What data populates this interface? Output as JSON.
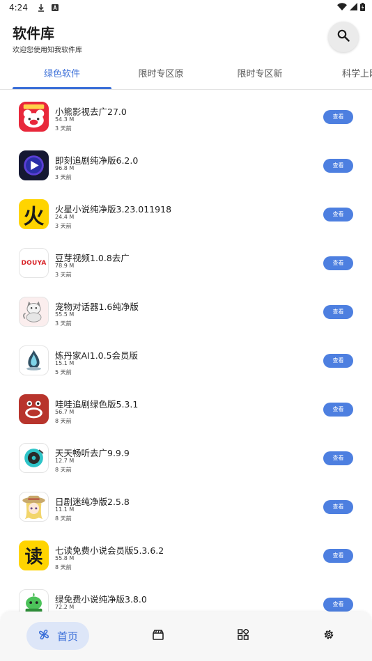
{
  "status_bar": {
    "time": "4:24"
  },
  "header": {
    "title": "软件库",
    "subtitle": "欢迎您使用知我软件库"
  },
  "tabs": [
    {
      "label": "绿色软件",
      "active": true
    },
    {
      "label": "限时专区原",
      "active": false
    },
    {
      "label": "限时专区新",
      "active": false
    },
    {
      "label": "科学上网",
      "active": false
    }
  ],
  "apps": [
    {
      "name": "小熊影视去广27.0",
      "size": "54.3 M",
      "time": "3 天前",
      "button": "查看",
      "icon": "bear-film-icon"
    },
    {
      "name": "即刻追剧纯净版6.2.0",
      "size": "96.8 M",
      "time": "3 天前",
      "button": "查看",
      "icon": "play-icon"
    },
    {
      "name": "火星小说纯净版3.23.011918",
      "size": "24.4 M",
      "time": "3 天前",
      "button": "查看",
      "icon": "fire-char-icon",
      "icon_text": "火"
    },
    {
      "name": "豆芽视频1.0.8去广",
      "size": "78.9 M",
      "time": "3 天前",
      "button": "查看",
      "icon": "douya-logo-icon",
      "icon_text": "DOUYA"
    },
    {
      "name": "宠物对话器1.6纯净版",
      "size": "55.5 M",
      "time": "3 天前",
      "button": "查看",
      "icon": "cat-icon"
    },
    {
      "name": "炼丹家AI1.0.5会员版",
      "size": "15.1 M",
      "time": "5 天前",
      "button": "查看",
      "icon": "crystal-icon"
    },
    {
      "name": "哇哇追剧绿色版5.3.1",
      "size": "56.7 M",
      "time": "8 天前",
      "button": "查看",
      "icon": "wawa-face-icon"
    },
    {
      "name": "天天畅听去广9.9.9",
      "size": "12.7 M",
      "time": "8 天前",
      "button": "查看",
      "icon": "vinyl-icon"
    },
    {
      "name": "日剧迷纯净版2.5.8",
      "size": "11.1 M",
      "time": "8 天前",
      "button": "查看",
      "icon": "anime-girl-icon"
    },
    {
      "name": "七读免费小说会员版5.3.6.2",
      "size": "55.8 M",
      "time": "8 天前",
      "button": "查看",
      "icon": "read-char-icon",
      "icon_text": "读"
    },
    {
      "name": "绿免费小说纯净版3.8.0",
      "size": "72.2 M",
      "time": "",
      "button": "查看",
      "icon": "green-mascot-icon"
    }
  ],
  "bottom_nav": {
    "home_label": "首页"
  },
  "colors": {
    "accent": "#3b6fd8",
    "button": "#4d7fe0",
    "home_pill": "#dde6f8"
  }
}
